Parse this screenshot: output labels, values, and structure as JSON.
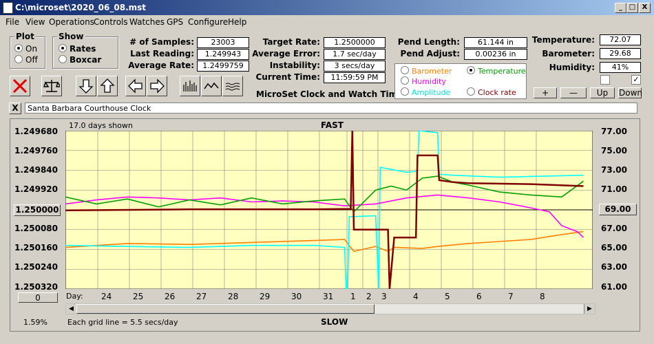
{
  "window": {
    "title": "C:\\microset\\2020_06_08.mst",
    "min": "_",
    "max": "□",
    "close": "X"
  },
  "menu": [
    "File",
    "View",
    "Operations",
    "Controls",
    "Watches",
    "GPS",
    "Configure",
    "Help"
  ],
  "plot_group": {
    "title": "Plot",
    "on": "On",
    "off": "Off"
  },
  "show_group": {
    "title": "Show",
    "rates": "Rates",
    "boxcar": "Boxcar"
  },
  "stats": {
    "samples_label": "# of Samples:",
    "samples": "23003",
    "last_label": "Last Reading:",
    "last": "1.249943",
    "avg_label": "Average Rate:",
    "avg": "1.2499759",
    "target_label": "Target Rate:",
    "target": "1.2500000",
    "avgerr_label": "Average Error:",
    "avgerr": "1.7 sec/day",
    "instab_label": "Instability:",
    "instab": "3 secs/day",
    "time_label": "Current Time:",
    "time": "11:59:59 PM",
    "pend_len_label": "Pend Length:",
    "pend_len": "61.144 in",
    "pend_adj_label": "Pend Adjust:",
    "pend_adj": "0.00236 in",
    "temp_label": "Temperature:",
    "temp": "72.07",
    "baro_label": "Barometer:",
    "baro": "29.68",
    "hum_label": "Humidity:",
    "hum": "41%"
  },
  "subtitle": "MicroSet Clock and Watch Timer",
  "sensor_select": {
    "barometer": "Barometer",
    "temperature": "Temperature",
    "humidity": "Humidity",
    "amplitude": "Amplitude",
    "clock_rate": "Clock rate",
    "colors": {
      "barometer": "#ff8000",
      "temperature": "#00a000",
      "humidity": "#ff00ff",
      "amplitude": "#00ffff",
      "clock_rate": "#800000"
    }
  },
  "adjust_buttons": {
    "plus": "+",
    "minus": "—",
    "up": "Up",
    "down": "Down"
  },
  "clock_name": "Santa Barbara Courthouse Clock",
  "close_x": "X",
  "plot": {
    "days_shown": "17.0 days shown",
    "fast": "FAST",
    "slow": "SLOW",
    "grid_note": "Each grid line = 5.5 secs/day",
    "percent": "1.59%",
    "day_label": "Day:",
    "center_btn": "1.250000",
    "right_btn": "69.00",
    "bottom_btn": "0",
    "left_ticks": [
      "1.249680",
      "1.249760",
      "1.249840",
      "1.249920",
      "1.250080",
      "1.250160",
      "1.250240",
      "1.250320"
    ],
    "right_ticks": [
      "77.00",
      "75.00",
      "73.00",
      "71.00",
      "67.00",
      "65.00",
      "63.00",
      "61.00"
    ],
    "days": [
      "24",
      "25",
      "26",
      "27",
      "28",
      "29",
      "30",
      "31",
      "1",
      "2",
      "3",
      "4",
      "5",
      "6",
      "7",
      "8"
    ]
  },
  "chart_data": {
    "type": "line",
    "title": "FAST",
    "xlabel": "Day:",
    "ylim_left": [
      1.25032,
      1.24968
    ],
    "ylim_right": [
      61,
      77
    ],
    "grid": true,
    "x_range_days": [
      0,
      17
    ],
    "series": [
      {
        "name": "Clock rate",
        "color": "#800000",
        "axis": "left",
        "x": [
          0,
          4,
          8,
          9.2,
          9.25,
          9.3,
          10.4,
          10.45,
          10.6,
          11.3,
          11.35,
          12.0,
          12.05,
          12.5,
          13.0,
          15.0,
          16.7
        ],
        "y": [
          1.250002,
          1.249998,
          1.249998,
          1.249996,
          1.24968,
          1.25008,
          1.25008,
          1.25032,
          1.250112,
          1.250112,
          1.24978,
          1.24978,
          1.24988,
          1.249888,
          1.249892,
          1.249896,
          1.249904
        ]
      },
      {
        "name": "Temperature",
        "color": "#00a000",
        "axis": "right",
        "x": [
          0,
          1,
          2,
          3,
          4,
          5,
          6,
          7,
          8,
          9,
          9.3,
          10,
          10.5,
          11,
          11.5,
          12,
          12.5,
          13,
          14,
          15,
          16,
          16.7
        ],
        "y": [
          70.3,
          69.6,
          70.1,
          69.3,
          70.0,
          69.5,
          70.2,
          69.6,
          69.9,
          70.1,
          68.8,
          71.0,
          71.4,
          71.0,
          72.2,
          72.4,
          71.8,
          71.5,
          70.8,
          70.5,
          70.3,
          71.9
        ]
      },
      {
        "name": "Humidity",
        "color": "#ff00ff",
        "axis": "right",
        "x": [
          0,
          1,
          2,
          3,
          4,
          5,
          6,
          7,
          8,
          9,
          10,
          11,
          12,
          13,
          14,
          15,
          15.6,
          16,
          16.5,
          16.7
        ],
        "y": [
          69.6,
          70.0,
          70.3,
          70.2,
          70.0,
          70.2,
          69.8,
          69.9,
          69.8,
          69.4,
          69.6,
          70.2,
          70.5,
          70.2,
          69.8,
          69.2,
          68.8,
          67.4,
          66.8,
          66.2
        ]
      },
      {
        "name": "Barometer",
        "color": "#ff8000",
        "axis": "right",
        "x": [
          0,
          2,
          4,
          6,
          8,
          9,
          9.3,
          10,
          10.4,
          10.6,
          11.5,
          12,
          13,
          14,
          15,
          16,
          16.7
        ],
        "y": [
          65.2,
          65.6,
          65.5,
          65.7,
          65.9,
          66.0,
          64.8,
          65.3,
          64.8,
          65.2,
          65.1,
          65.3,
          65.6,
          65.8,
          66.0,
          66.5,
          66.8
        ]
      },
      {
        "name": "Amplitude",
        "color": "#00ffff",
        "axis": "right",
        "x": [
          0,
          2,
          4,
          6,
          8,
          9.0,
          9.05,
          9.1,
          9.15,
          10.0,
          10.1,
          10.15,
          11.0,
          11.35,
          11.4,
          12.0,
          12.05,
          12.5,
          14.0,
          16.7
        ],
        "y": [
          65.4,
          65.3,
          65.2,
          65.4,
          65.4,
          65.2,
          61.0,
          61.0,
          68.3,
          68.4,
          61.0,
          73.3,
          72.8,
          72.9,
          77.0,
          76.8,
          72.6,
          72.5,
          72.3,
          72.5
        ]
      }
    ]
  }
}
